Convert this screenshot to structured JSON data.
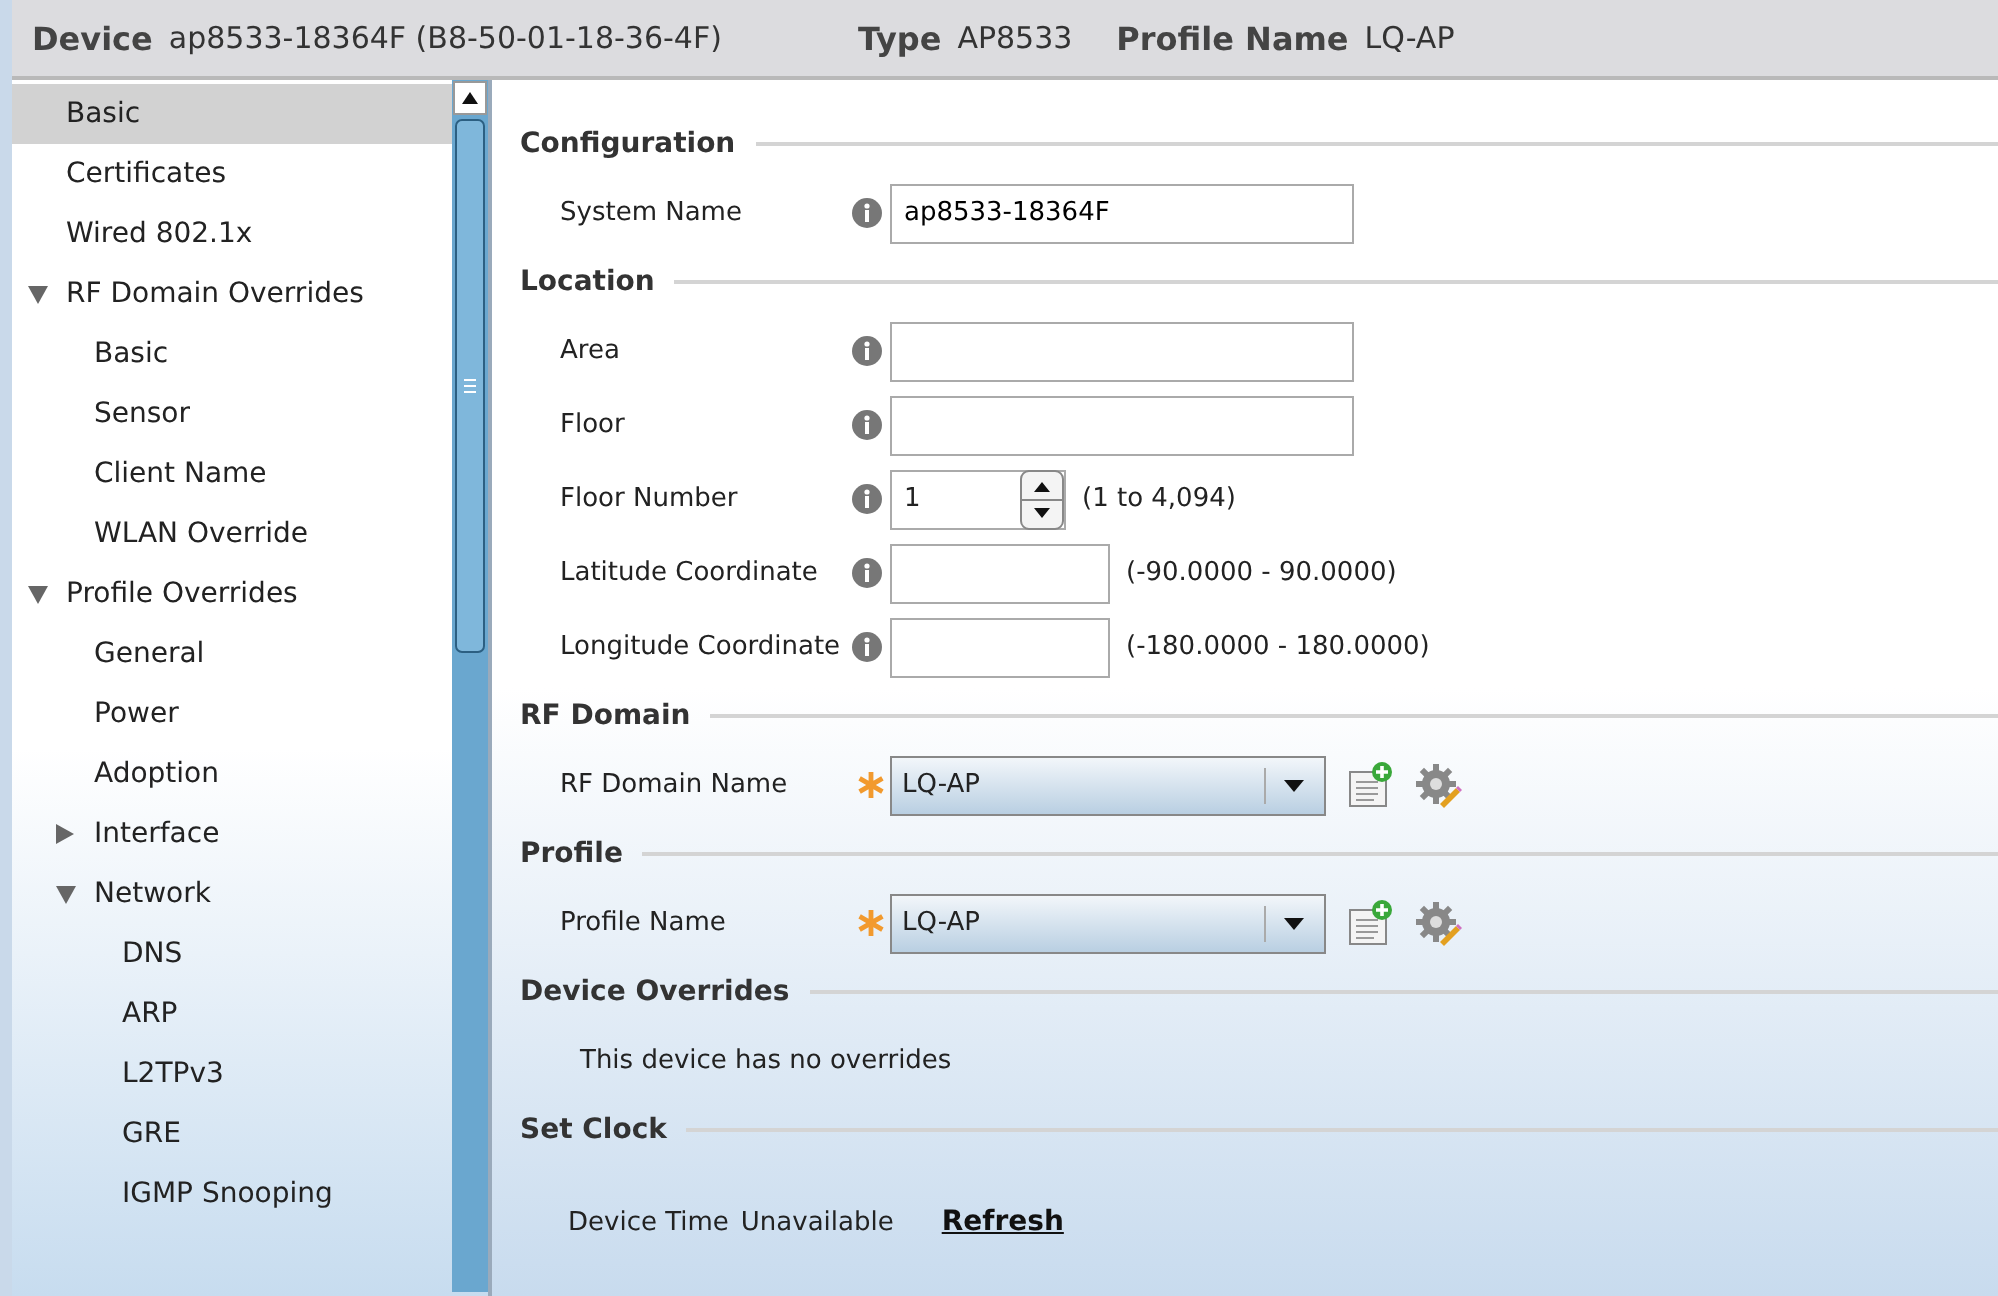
{
  "header": {
    "fields": [
      {
        "label": "Device",
        "value": "ap8533-18364F (B8-50-01-18-36-4F)"
      },
      {
        "label": "Type",
        "value": "AP8533"
      },
      {
        "label": "Profile Name",
        "value": "LQ-AP"
      }
    ]
  },
  "sidebar": {
    "items": [
      {
        "label": "Basic",
        "selected": true
      },
      {
        "label": "Certificates",
        "selected": false
      },
      {
        "label": "Wired 802.1x",
        "selected": false
      },
      {
        "label": "RF Domain Overrides",
        "selected": false,
        "expanded": true,
        "children": [
          {
            "label": "Basic",
            "selected": false
          },
          {
            "label": "Sensor",
            "selected": false
          },
          {
            "label": "Client Name",
            "selected": false
          },
          {
            "label": "WLAN Override",
            "selected": false
          }
        ]
      },
      {
        "label": "Profile Overrides",
        "selected": false,
        "expanded": true,
        "children": [
          {
            "label": "General",
            "selected": false
          },
          {
            "label": "Power",
            "selected": false
          },
          {
            "label": "Adoption",
            "selected": false
          },
          {
            "label": "Interface",
            "selected": false,
            "expanded": false
          },
          {
            "label": "Network",
            "selected": false,
            "expanded": true,
            "children": [
              {
                "label": "DNS",
                "selected": false
              },
              {
                "label": "ARP",
                "selected": false
              },
              {
                "label": "L2TPv3",
                "selected": false
              },
              {
                "label": "GRE",
                "selected": false
              },
              {
                "label": "IGMP Snooping",
                "selected": false
              }
            ]
          }
        ]
      }
    ]
  },
  "sections": [
    {
      "title": "Configuration",
      "rows": [
        {
          "kind": "text",
          "label": "System Name",
          "value": "ap8533-18364F"
        }
      ]
    },
    {
      "title": "Location",
      "rows": [
        {
          "kind": "text",
          "label": "Area"
        },
        {
          "kind": "text",
          "label": "Floor"
        },
        {
          "kind": "spinner",
          "label": "Floor Number",
          "value": "1",
          "hint": "(1 to 4,094)"
        },
        {
          "kind": "text",
          "label": "Latitude Coordinate",
          "hint": "(-90.0000 - 90.0000)"
        },
        {
          "kind": "text",
          "label": "Longitude Coordinate",
          "hint": "(-180.0000 - 180.0000)"
        }
      ]
    },
    {
      "title": "RF Domain",
      "rows": [
        {
          "kind": "select",
          "label": "RF Domain Name",
          "value": "LQ-AP",
          "required": true
        }
      ]
    },
    {
      "title": "Profile",
      "rows": [
        {
          "kind": "select",
          "label": "Profile Name",
          "value": "LQ-AP",
          "required": true
        }
      ]
    },
    {
      "title": "Device Overrides",
      "rows": [
        {
          "kind": "message",
          "label": "This device has no overrides"
        }
      ]
    },
    {
      "title": "Set Clock",
      "rows": [
        {
          "kind": "clock",
          "label": "Device Time",
          "value": "Unavailable",
          "link": "Refresh"
        }
      ]
    }
  ]
}
